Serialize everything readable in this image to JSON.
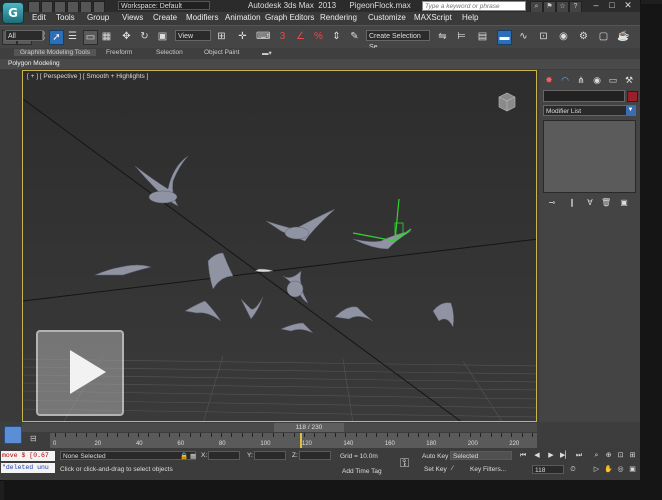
{
  "app": {
    "logo_letter": "G",
    "workspace": "Workspace: Default",
    "title": "Autodesk 3ds Max  2013      PigeonFlock.max",
    "search_placeholder": "Type a keyword or phrase"
  },
  "menu": [
    "Edit",
    "Tools",
    "Group",
    "Views",
    "Create",
    "Modifiers",
    "Animation",
    "Graph Editors",
    "Rendering",
    "Customize",
    "MAXScript",
    "Help"
  ],
  "toolbar": {
    "filter": "All",
    "ref_coord": "View",
    "selection_set": "Create Selection Se"
  },
  "ribbon": {
    "tabs": [
      "Graphite Modeling Tools",
      "Freeform",
      "Selection",
      "Object Paint"
    ],
    "panel": "Polygon Modeling"
  },
  "viewport": {
    "label": "[ + ] [ Perspective ] [ Smooth + Highlights ]"
  },
  "command_panel": {
    "modifier_list": "Modifier List"
  },
  "time_slider": {
    "current": "118 / 230",
    "ticks": [
      "0",
      "20",
      "40",
      "60",
      "80",
      "100",
      "120",
      "140",
      "160",
      "180",
      "200",
      "220"
    ],
    "position_fraction": 0.513
  },
  "status": {
    "maxscript_in": "move $ [0.67",
    "maxscript_out": "\"deleted unu",
    "selection": "None Selected",
    "prompt": "Click or click-and-drag to select objects",
    "x_label": "X:",
    "y_label": "Y:",
    "z_label": "Z:",
    "grid": "Grid = 10.0m",
    "add_time_tag": "Add Time Tag",
    "auto_key": "Auto Key",
    "set_key": "Set Key",
    "key_mode": "Selected",
    "key_filters": "Key Filters...",
    "frame": "118"
  }
}
